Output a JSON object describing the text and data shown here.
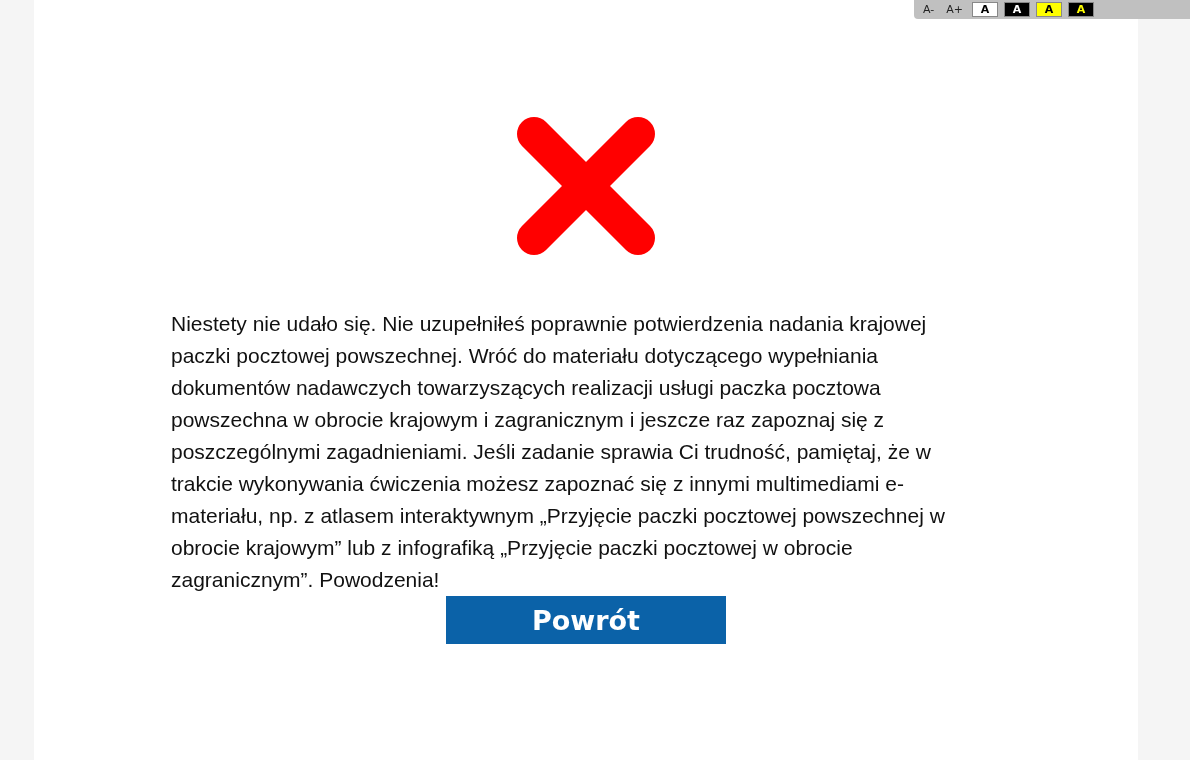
{
  "toolbar": {
    "buttons": [
      {
        "label": "A-",
        "kind": "text"
      },
      {
        "label": "A+",
        "kind": "text"
      },
      {
        "label": "A",
        "kind": "darkletter",
        "color": "#ffffff"
      },
      {
        "label": "A",
        "kind": "whiteletter",
        "color": "#000000"
      },
      {
        "label": "A",
        "kind": "darkletter",
        "color": "#ffff00"
      },
      {
        "label": "A",
        "kind": "yellowletter",
        "color": "#000000"
      }
    ]
  },
  "result": {
    "message": "Niestety nie udało się. Nie uzupełniłeś poprawnie potwierdzenia nadania krajowej paczki pocztowej powszechnej. Wróć do materiału dotyczącego wypełniania dokumentów nadawczych towarzyszących realizacji usługi paczka pocztowa powszechna w obrocie krajowym i zagranicznym i jeszcze raz zapoznaj się z poszczególnymi zagadnieniami. Jeśli zadanie sprawia Ci trudność, pamiętaj, że w trakcie wykonywania ćwiczenia możesz zapoznać się z innymi multimediami e-materiału, np. z atlasem interaktywnym „Przyjęcie paczki pocztowej powszechnej w obrocie krajowym” lub z infografiką „Przyjęcie paczki pocztowej w obrocie zagranicznym”. Powodzenia!",
    "button": "Powrót"
  }
}
